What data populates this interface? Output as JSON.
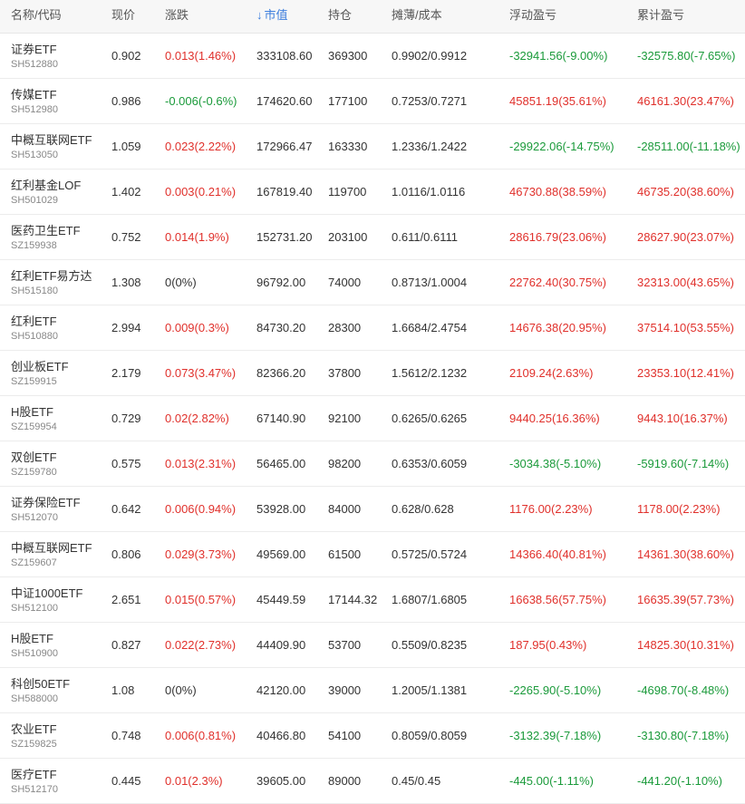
{
  "colors": {
    "up": "#e0302b",
    "down": "#1a9a3a",
    "sort_accent": "#3b7ddd"
  },
  "header": {
    "name_code": "名称/代码",
    "price": "现价",
    "change": "涨跌",
    "sort_icon": "down-arrow-icon",
    "market_value": "市值",
    "position": "持仓",
    "cost": "摊薄/成本",
    "floating_pnl": "浮动盈亏",
    "accumulated_pnl": "累计盈亏"
  },
  "rows": [
    {
      "name": "证券ETF",
      "code": "SH512880",
      "price": "0.902",
      "change": "0.013(1.46%)",
      "change_dir": "up",
      "market_value": "333108.60",
      "position": "369300",
      "cost": "0.9902/0.9912",
      "floating": "-32941.56(-9.00%)",
      "floating_dir": "down",
      "accumulated": "-32575.80(-7.65%)",
      "accumulated_dir": "down"
    },
    {
      "name": "传媒ETF",
      "code": "SH512980",
      "price": "0.986",
      "change": "-0.006(-0.6%)",
      "change_dir": "down",
      "market_value": "174620.60",
      "position": "177100",
      "cost": "0.7253/0.7271",
      "floating": "45851.19(35.61%)",
      "floating_dir": "up",
      "accumulated": "46161.30(23.47%)",
      "accumulated_dir": "up"
    },
    {
      "name": "中概互联网ETF",
      "code": "SH513050",
      "price": "1.059",
      "change": "0.023(2.22%)",
      "change_dir": "up",
      "market_value": "172966.47",
      "position": "163330",
      "cost": "1.2336/1.2422",
      "floating": "-29922.06(-14.75%)",
      "floating_dir": "down",
      "accumulated": "-28511.00(-11.18%)",
      "accumulated_dir": "down"
    },
    {
      "name": "红利基金LOF",
      "code": "SH501029",
      "price": "1.402",
      "change": "0.003(0.21%)",
      "change_dir": "up",
      "market_value": "167819.40",
      "position": "119700",
      "cost": "1.0116/1.0116",
      "floating": "46730.88(38.59%)",
      "floating_dir": "up",
      "accumulated": "46735.20(38.60%)",
      "accumulated_dir": "up"
    },
    {
      "name": "医药卫生ETF",
      "code": "SZ159938",
      "price": "0.752",
      "change": "0.014(1.9%)",
      "change_dir": "up",
      "market_value": "152731.20",
      "position": "203100",
      "cost": "0.611/0.6111",
      "floating": "28616.79(23.06%)",
      "floating_dir": "up",
      "accumulated": "28627.90(23.07%)",
      "accumulated_dir": "up"
    },
    {
      "name": "红利ETF易方达",
      "code": "SH515180",
      "price": "1.308",
      "change": "0(0%)",
      "change_dir": "flat",
      "market_value": "96792.00",
      "position": "74000",
      "cost": "0.8713/1.0004",
      "floating": "22762.40(30.75%)",
      "floating_dir": "up",
      "accumulated": "32313.00(43.65%)",
      "accumulated_dir": "up"
    },
    {
      "name": "红利ETF",
      "code": "SH510880",
      "price": "2.994",
      "change": "0.009(0.3%)",
      "change_dir": "up",
      "market_value": "84730.20",
      "position": "28300",
      "cost": "1.6684/2.4754",
      "floating": "14676.38(20.95%)",
      "floating_dir": "up",
      "accumulated": "37514.10(53.55%)",
      "accumulated_dir": "up"
    },
    {
      "name": "创业板ETF",
      "code": "SZ159915",
      "price": "2.179",
      "change": "0.073(3.47%)",
      "change_dir": "up",
      "market_value": "82366.20",
      "position": "37800",
      "cost": "1.5612/2.1232",
      "floating": "2109.24(2.63%)",
      "floating_dir": "up",
      "accumulated": "23353.10(12.41%)",
      "accumulated_dir": "up"
    },
    {
      "name": "H股ETF",
      "code": "SZ159954",
      "price": "0.729",
      "change": "0.02(2.82%)",
      "change_dir": "up",
      "market_value": "67140.90",
      "position": "92100",
      "cost": "0.6265/0.6265",
      "floating": "9440.25(16.36%)",
      "floating_dir": "up",
      "accumulated": "9443.10(16.37%)",
      "accumulated_dir": "up"
    },
    {
      "name": "双创ETF",
      "code": "SZ159780",
      "price": "0.575",
      "change": "0.013(2.31%)",
      "change_dir": "up",
      "market_value": "56465.00",
      "position": "98200",
      "cost": "0.6353/0.6059",
      "floating": "-3034.38(-5.10%)",
      "floating_dir": "down",
      "accumulated": "-5919.60(-7.14%)",
      "accumulated_dir": "down"
    },
    {
      "name": "证券保险ETF",
      "code": "SH512070",
      "price": "0.642",
      "change": "0.006(0.94%)",
      "change_dir": "up",
      "market_value": "53928.00",
      "position": "84000",
      "cost": "0.628/0.628",
      "floating": "1176.00(2.23%)",
      "floating_dir": "up",
      "accumulated": "1178.00(2.23%)",
      "accumulated_dir": "up"
    },
    {
      "name": "中概互联网ETF",
      "code": "SZ159607",
      "price": "0.806",
      "change": "0.029(3.73%)",
      "change_dir": "up",
      "market_value": "49569.00",
      "position": "61500",
      "cost": "0.5725/0.5724",
      "floating": "14366.40(40.81%)",
      "floating_dir": "up",
      "accumulated": "14361.30(38.60%)",
      "accumulated_dir": "up"
    },
    {
      "name": "中证1000ETF",
      "code": "SH512100",
      "price": "2.651",
      "change": "0.015(0.57%)",
      "change_dir": "up",
      "market_value": "45449.59",
      "position": "17144.32",
      "cost": "1.6807/1.6805",
      "floating": "16638.56(57.75%)",
      "floating_dir": "up",
      "accumulated": "16635.39(57.73%)",
      "accumulated_dir": "up"
    },
    {
      "name": "H股ETF",
      "code": "SH510900",
      "price": "0.827",
      "change": "0.022(2.73%)",
      "change_dir": "up",
      "market_value": "44409.90",
      "position": "53700",
      "cost": "0.5509/0.8235",
      "floating": "187.95(0.43%)",
      "floating_dir": "up",
      "accumulated": "14825.30(10.31%)",
      "accumulated_dir": "up"
    },
    {
      "name": "科创50ETF",
      "code": "SH588000",
      "price": "1.08",
      "change": "0(0%)",
      "change_dir": "flat",
      "market_value": "42120.00",
      "position": "39000",
      "cost": "1.2005/1.1381",
      "floating": "-2265.90(-5.10%)",
      "floating_dir": "down",
      "accumulated": "-4698.70(-8.48%)",
      "accumulated_dir": "down"
    },
    {
      "name": "农业ETF",
      "code": "SZ159825",
      "price": "0.748",
      "change": "0.006(0.81%)",
      "change_dir": "up",
      "market_value": "40466.80",
      "position": "54100",
      "cost": "0.8059/0.8059",
      "floating": "-3132.39(-7.18%)",
      "floating_dir": "down",
      "accumulated": "-3130.80(-7.18%)",
      "accumulated_dir": "down"
    },
    {
      "name": "医疗ETF",
      "code": "SH512170",
      "price": "0.445",
      "change": "0.01(2.3%)",
      "change_dir": "up",
      "market_value": "39605.00",
      "position": "89000",
      "cost": "0.45/0.45",
      "floating": "-445.00(-1.11%)",
      "floating_dir": "down",
      "accumulated": "-441.20(-1.10%)",
      "accumulated_dir": "down"
    }
  ]
}
